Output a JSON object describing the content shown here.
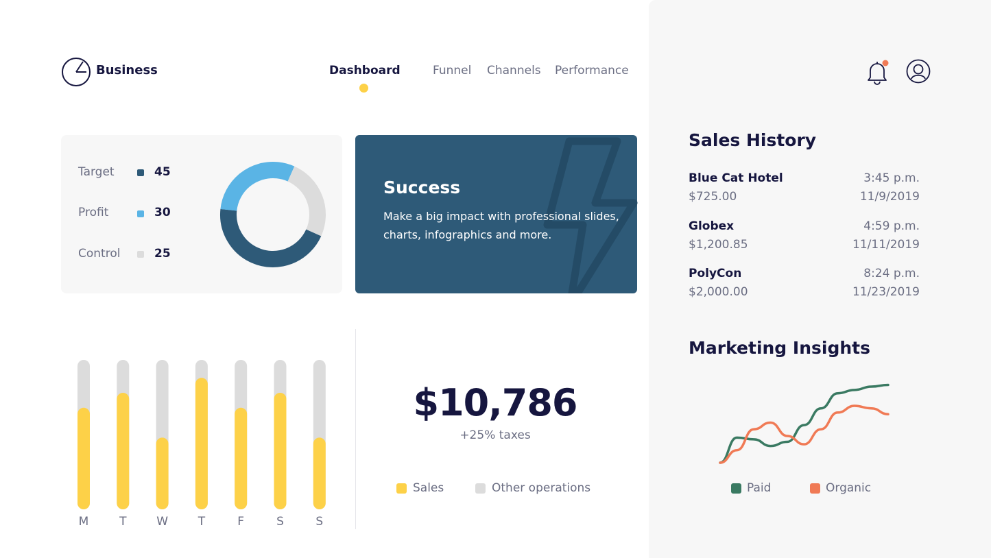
{
  "header": {
    "brand": "Business",
    "nav": [
      {
        "label": "Dashboard",
        "active": true
      },
      {
        "label": "Funnel",
        "active": false
      },
      {
        "label": "Channels",
        "active": false
      },
      {
        "label": "Performance",
        "active": false
      }
    ],
    "icons": [
      "pie-chart-logo-icon",
      "bell-icon",
      "user-icon"
    ],
    "notification_dot_color": "#f07a55"
  },
  "metrics": {
    "items": [
      {
        "label": "Target",
        "value": "45",
        "color": "#2e5a78"
      },
      {
        "label": "Profit",
        "value": "30",
        "color": "#5ab4e5"
      },
      {
        "label": "Control",
        "value": "25",
        "color": "#dcdcdc"
      }
    ]
  },
  "success": {
    "title": "Success",
    "text": "Make a big impact with professional slides, charts, infographics and more.",
    "background": "#2e5a78"
  },
  "summary": {
    "total": "$10,786",
    "taxes": "+25% taxes",
    "legend": [
      {
        "label": "Sales",
        "color": "#fdd148"
      },
      {
        "label": "Other operations",
        "color": "#dcdcdc"
      }
    ]
  },
  "sales_history": {
    "title": "Sales History",
    "items": [
      {
        "name": "Blue Cat Hotel",
        "amount": "$725.00",
        "time": "3:45 p.m.",
        "date": "11/9/2019"
      },
      {
        "name": "Globex",
        "amount": "$1,200.85",
        "time": "4:59 p.m.",
        "date": "11/11/2019"
      },
      {
        "name": "PolyCon",
        "amount": "$2,000.00",
        "time": "8:24 p.m.",
        "date": "11/23/2019"
      }
    ]
  },
  "marketing": {
    "title": "Marketing Insights",
    "legend": [
      {
        "label": "Paid",
        "color": "#3a7a62"
      },
      {
        "label": "Organic",
        "color": "#f07a55"
      }
    ]
  },
  "chart_data": [
    {
      "type": "pie",
      "categories": [
        "Target",
        "Profit",
        "Control"
      ],
      "values": [
        45,
        30,
        25
      ],
      "colors": [
        "#2e5a78",
        "#5ab4e5",
        "#dcdcdc"
      ]
    },
    {
      "type": "bar",
      "categories": [
        "M",
        "T",
        "W",
        "T",
        "F",
        "S",
        "S"
      ],
      "series": [
        {
          "name": "Sales",
          "values": [
            68,
            78,
            48,
            88,
            68,
            78,
            48
          ],
          "color": "#fdd148"
        },
        {
          "name": "Other operations",
          "values": [
            32,
            22,
            52,
            12,
            32,
            22,
            52
          ],
          "color": "#dcdcdc"
        }
      ],
      "stacked": true,
      "ylim": [
        0,
        100
      ]
    },
    {
      "type": "line",
      "x": [
        0,
        1,
        2,
        3,
        4,
        5,
        6,
        7,
        8,
        9,
        10
      ],
      "series": [
        {
          "name": "Paid",
          "values": [
            0,
            30,
            28,
            20,
            25,
            45,
            65,
            83,
            87,
            91,
            93
          ],
          "color": "#3a7a62"
        },
        {
          "name": "Organic",
          "values": [
            0,
            15,
            40,
            48,
            32,
            22,
            40,
            60,
            68,
            65,
            58
          ],
          "color": "#f07a55"
        }
      ],
      "ylim": [
        0,
        100
      ]
    }
  ]
}
